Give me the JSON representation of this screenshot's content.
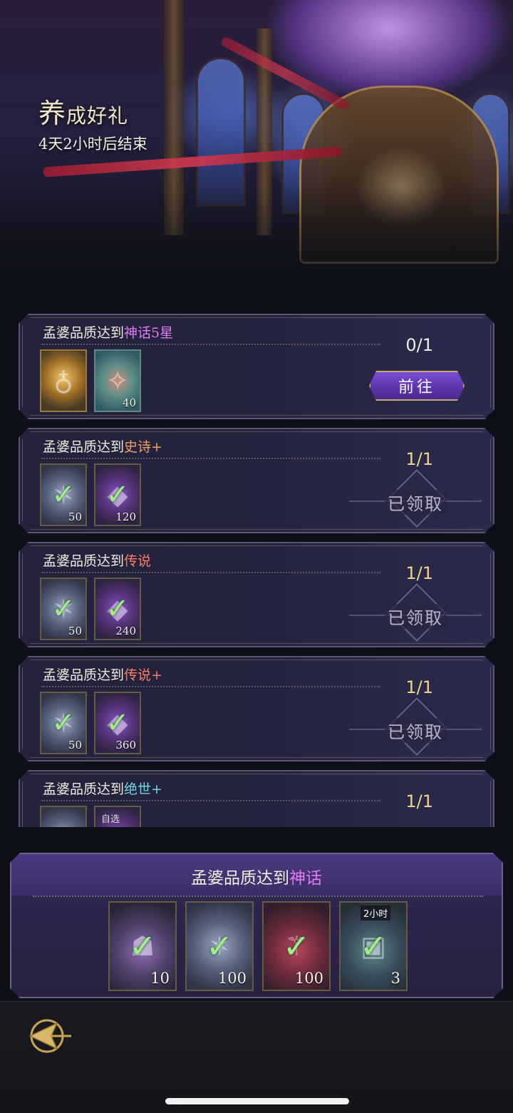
{
  "event": {
    "title_first": "养",
    "title_rest": "成好礼",
    "timer": "4天2小时后结束"
  },
  "colors": {
    "myth": "#e07cf5",
    "epic": "#f0a060",
    "legend": "#ff7a6b",
    "peerless": "#6fd7e8",
    "check": "#9cf08b"
  },
  "tasks": [
    {
      "title_prefix": "孟婆品质达到",
      "title_highlight": "神话5星",
      "progress": "0/1",
      "action": "前往",
      "rewards": [
        {
          "icon": "golden-lock-icon",
          "qty": ""
        },
        {
          "icon": "jeweled-staff-icon",
          "qty": "40"
        }
      ]
    },
    {
      "title_prefix": "孟婆品质达到",
      "title_highlight": "史诗+",
      "progress": "1/1",
      "status": "已领取",
      "rewards": [
        {
          "icon": "star-crystal-icon",
          "qty": "50"
        },
        {
          "icon": "purple-gem-icon",
          "qty": "120"
        }
      ]
    },
    {
      "title_prefix": "孟婆品质达到",
      "title_highlight": "传说",
      "progress": "1/1",
      "status": "已领取",
      "rewards": [
        {
          "icon": "star-crystal-icon",
          "qty": "50"
        },
        {
          "icon": "purple-gem-icon",
          "qty": "240"
        }
      ]
    },
    {
      "title_prefix": "孟婆品质达到",
      "title_highlight": "传说+",
      "progress": "1/1",
      "status": "已领取",
      "rewards": [
        {
          "icon": "star-crystal-icon",
          "qty": "50"
        },
        {
          "icon": "purple-gem-icon",
          "qty": "360"
        }
      ]
    },
    {
      "title_prefix": "孟婆品质达到",
      "title_highlight": "绝世+",
      "progress": "1/1",
      "rewards": [
        {
          "icon": "star-crystal-icon",
          "qty": ""
        },
        {
          "icon": "selectable-chest-icon",
          "tag": "自选",
          "qty": ""
        }
      ]
    }
  ],
  "final": {
    "title_prefix": "孟婆品质达到",
    "title_highlight": "神话",
    "rewards": [
      {
        "icon": "ore-pile-icon",
        "qty": "10"
      },
      {
        "icon": "star-crystal-icon",
        "qty": "100"
      },
      {
        "icon": "ruby-scepter-icon",
        "qty": "100"
      },
      {
        "icon": "treasure-chest-icon",
        "qty": "3",
        "time_tag": "2小时"
      }
    ]
  },
  "nav": {
    "back_icon": "back-arrow-icon"
  }
}
